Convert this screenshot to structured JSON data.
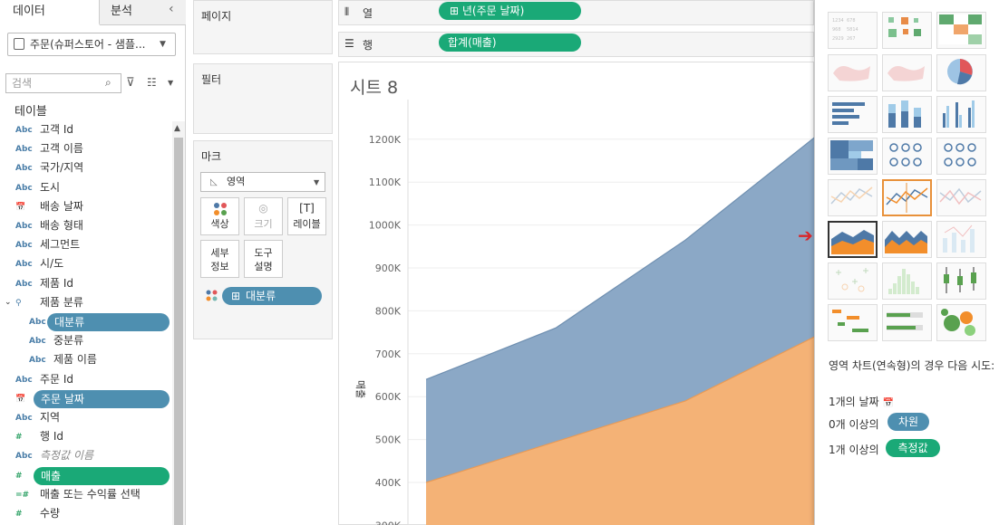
{
  "tabs": {
    "data": "데이터",
    "analysis": "분석"
  },
  "datasource": {
    "label": "주문(슈퍼스토어 - 샘플..."
  },
  "search": {
    "placeholder": "검색"
  },
  "tables_label": "테이블",
  "fields": [
    {
      "type": "Abc",
      "name": "고객 Id"
    },
    {
      "type": "Abc",
      "name": "고객 이름"
    },
    {
      "type": "Abc",
      "name": "국가/지역"
    },
    {
      "type": "Abc",
      "name": "도시"
    },
    {
      "type": "date",
      "name": "배송 날짜"
    },
    {
      "type": "Abc",
      "name": "배송 형태"
    },
    {
      "type": "Abc",
      "name": "세그먼트"
    },
    {
      "type": "Abc",
      "name": "시/도"
    },
    {
      "type": "Abc",
      "name": "제품 Id"
    },
    {
      "type": "hier",
      "name": "제품 분류"
    },
    {
      "type": "Abc",
      "name": "대분류",
      "pill": "blue",
      "indent": true
    },
    {
      "type": "Abc",
      "name": "중분류",
      "indent": true
    },
    {
      "type": "Abc",
      "name": "제품 이름",
      "indent": true
    },
    {
      "type": "Abc",
      "name": "주문 Id"
    },
    {
      "type": "date",
      "name": "주문 날짜",
      "pill": "blue"
    },
    {
      "type": "Abc",
      "name": "지역"
    },
    {
      "type": "#",
      "name": "행 Id"
    },
    {
      "type": "Abc",
      "name": "측정값 이름",
      "italic": true
    },
    {
      "type": "#",
      "name": "매출",
      "pill": "green"
    },
    {
      "type": "=#",
      "name": "매출 또는 수익률 선택"
    },
    {
      "type": "#",
      "name": "수량"
    }
  ],
  "cards": {
    "pages": "페이지",
    "filters": "필터",
    "marks": "마크"
  },
  "marks": {
    "type": "영역",
    "buttons": [
      "색상",
      "크기",
      "레이블",
      "세부\n정보",
      "도구\n설명"
    ],
    "pill": "대분류"
  },
  "shelves": {
    "columns_label": "열",
    "rows_label": "행",
    "columns_pill": "년(주문 날짜)",
    "rows_pill": "합계(매출)"
  },
  "sheet_title": "시트 8",
  "chart_data": {
    "type": "area",
    "ylabel": "매출",
    "yticks": [
      "1200K",
      "1100K",
      "1000K",
      "900K",
      "800K",
      "700K",
      "600K",
      "500K",
      "400K",
      "300K"
    ],
    "ylim": [
      300000,
      1250000
    ],
    "x": [
      0,
      1,
      2,
      3
    ],
    "series": [
      {
        "values": [
          400000,
          495000,
          590000,
          740000
        ],
        "color": "#f4b276"
      },
      {
        "values": [
          640000,
          760000,
          965000,
          1205000
        ],
        "color": "#8ba8c6"
      }
    ]
  },
  "showme": {
    "description": "영역 차트(연속형)의 경우 다음 시도:",
    "req1": "1개의 날짜",
    "req2_pre": "0개 이상의",
    "req2_pill": "차원",
    "req3_pre": "1개 이상의",
    "req3_pill": "측정값"
  },
  "colors": {
    "blue_pill": "#4e8fb0",
    "green_pill": "#1aa977"
  }
}
